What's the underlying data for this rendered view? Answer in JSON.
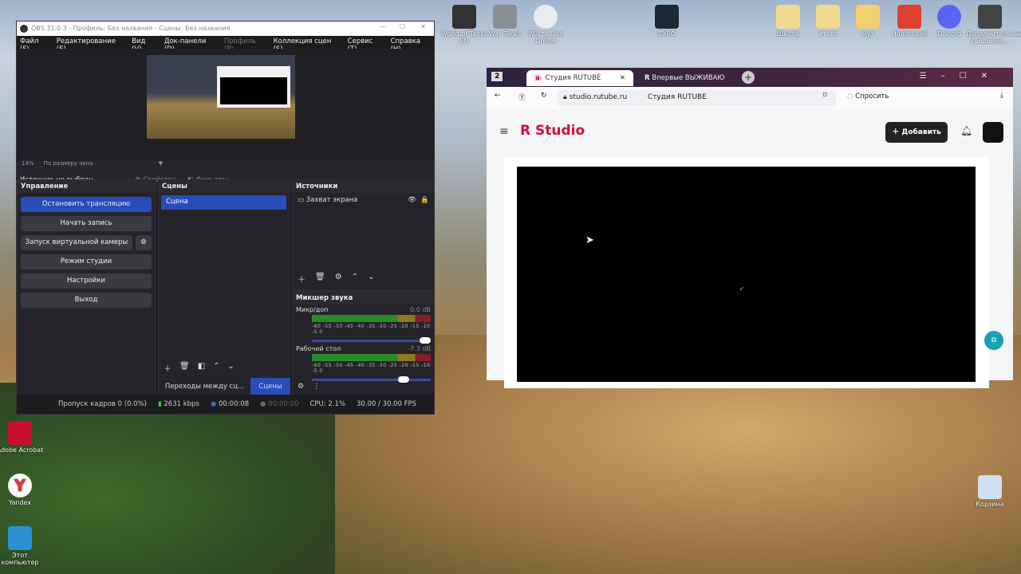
{
  "desktop": {
    "top_icons": [
      "World of Tanks EU",
      "War Tanks",
      "Will to Live Online",
      "EXBO",
      "Школа",
      "итого",
      "муз",
      "Налоговая",
      "Discord",
      "Дополнительные сведения..."
    ],
    "left_icons": [
      "Adobe Acrobat",
      "Yandex",
      "Этот компьютер"
    ],
    "recycle_bin": "Корзина"
  },
  "obs": {
    "title": "OBS 31.0.3 - Профиль: Без названия - Сцены: Без названия",
    "menu": [
      "Файл (F)",
      "Редактирование (E)",
      "Вид (V)",
      "Док-панели (D)",
      "Профиль (P)",
      "Коллекция сцен (S)",
      "Сервис (T)",
      "Справка (H)"
    ],
    "zoom": "14%",
    "zoom_mode": "По размеру окна",
    "no_source": "Источник не выбран",
    "properties": "Свойства",
    "filters": "Фильтры",
    "controls": {
      "title": "Управление",
      "buttons": [
        "Остановить трансляцию",
        "Начать запись",
        "Запуск виртуальной камеры",
        "Режим студии",
        "Настройки",
        "Выход"
      ]
    },
    "scenes": {
      "title": "Сцены",
      "items": [
        "Сцена"
      ],
      "tab_transitions": "Переходы между сц...",
      "tab_scenes": "Сцены"
    },
    "sources": {
      "title": "Источники",
      "items": [
        "Захват экрана"
      ]
    },
    "mixer": {
      "title": "Микшер звука",
      "channels": [
        {
          "name": "Микр/доп",
          "db": "0.0 dB",
          "level": 1.0
        },
        {
          "name": "Рабочий стол",
          "db": "-7.3 dB",
          "level": 0.82
        }
      ],
      "ticks": "-60 -55 -50 -45 -40 -35 -30 -25 -20 -15 -10 -5 0"
    },
    "status": {
      "dropped": "Пропуск кадров 0 (0.0%)",
      "bitrate": "2631 kbps",
      "stream_time": "00:00:08",
      "rec_time": "00:00:00",
      "cpu": "CPU: 2.1%",
      "fps": "30.00 / 30.00 FPS"
    }
  },
  "browser": {
    "tab_count": "2",
    "tabs": [
      "Студия RUTUBE",
      "Впервые ВЫЖИВАЮ"
    ],
    "url": "studio.rutube.ru",
    "page_title": "Студия RUTUBE",
    "ask": "Спросить",
    "logo": "R Studio",
    "add_button": "Добавить"
  }
}
